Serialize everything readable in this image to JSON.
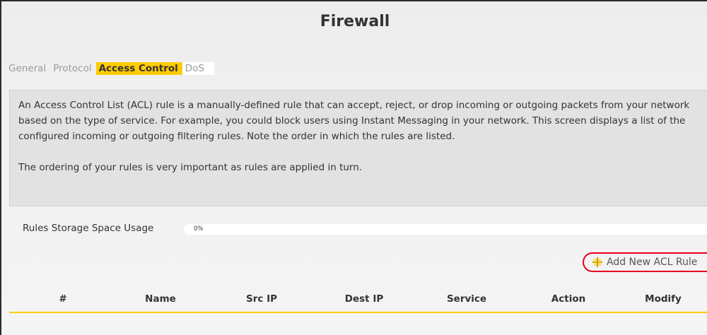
{
  "page": {
    "title": "Firewall"
  },
  "tabs": [
    {
      "label": "General",
      "active": false
    },
    {
      "label": "Protocol",
      "active": false
    },
    {
      "label": "Access Control",
      "active": true
    },
    {
      "label": "DoS",
      "active": false
    }
  ],
  "description": {
    "paragraph1": "An Access Control List (ACL) rule is a manually-defined rule that can accept, reject, or drop incoming or outgoing packets from your network based on the type of service. For example, you could block users using Instant Messaging in your network. This screen displays a list of the configured incoming or outgoing filtering rules. Note the order in which the rules are listed.",
    "paragraph2": "The ordering of your rules is very important as rules are applied in turn."
  },
  "storage": {
    "label": "Rules Storage Space Usage",
    "value": "0%",
    "fraction": 0
  },
  "actions": {
    "add_label": "Add New ACL Rule",
    "add_icon": "plus-icon"
  },
  "table": {
    "columns": [
      "#",
      "Name",
      "Src IP",
      "Dest IP",
      "Service",
      "Action",
      "Modify"
    ],
    "rows": []
  },
  "colors": {
    "accent": "#ffcb05",
    "highlight_ring": "#e8001c",
    "panel": "#e2e2e2",
    "text": "#333333"
  }
}
